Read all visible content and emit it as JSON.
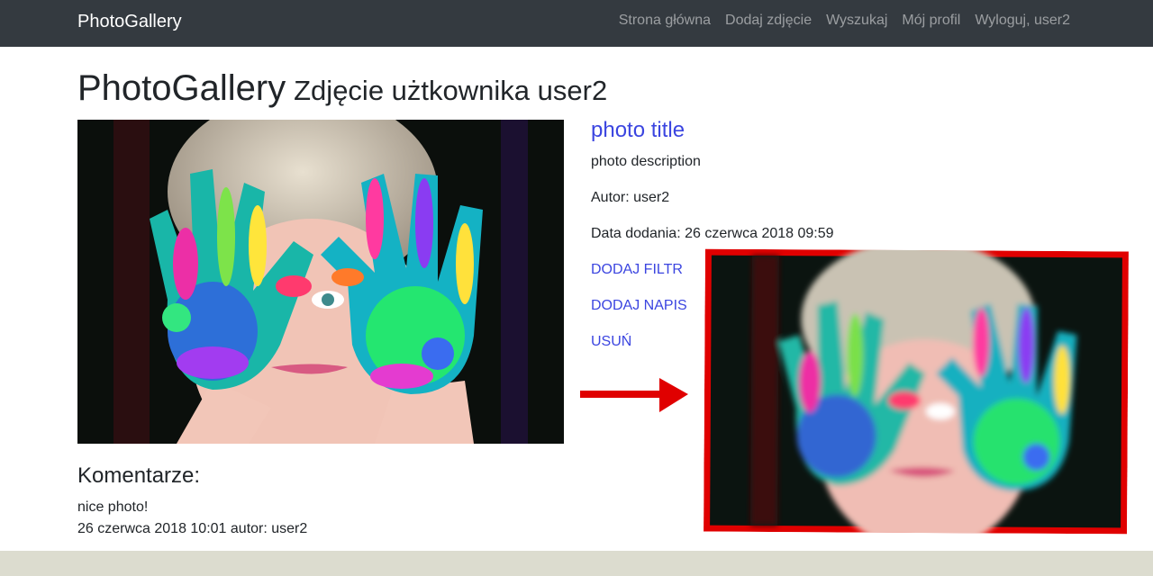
{
  "navbar": {
    "brand": "PhotoGallery",
    "links": [
      "Strona główna",
      "Dodaj zdjęcie",
      "Wyszukaj",
      "Mój profil",
      "Wyloguj, user2"
    ]
  },
  "heading": {
    "title": "PhotoGallery",
    "subtitle": "Zdjęcie użtkownika user2"
  },
  "photo": {
    "title": "photo title",
    "description": "photo description",
    "author": "Autor: user2",
    "date_added": "Data dodania: 26 czerwca 2018 09:59",
    "actions": [
      "DODAJ FILTR",
      "DODAJ NAPIS",
      "USUŃ"
    ]
  },
  "comments": {
    "title": "Komentarze:",
    "items": [
      {
        "text": "nice photo!",
        "meta": "26 czerwca 2018 10:01 autor: user2"
      }
    ]
  },
  "colors": {
    "navbar_bg": "#343a40",
    "link": "#3b45e0",
    "annotation": "#e00000",
    "footer": "#dcdccf"
  }
}
